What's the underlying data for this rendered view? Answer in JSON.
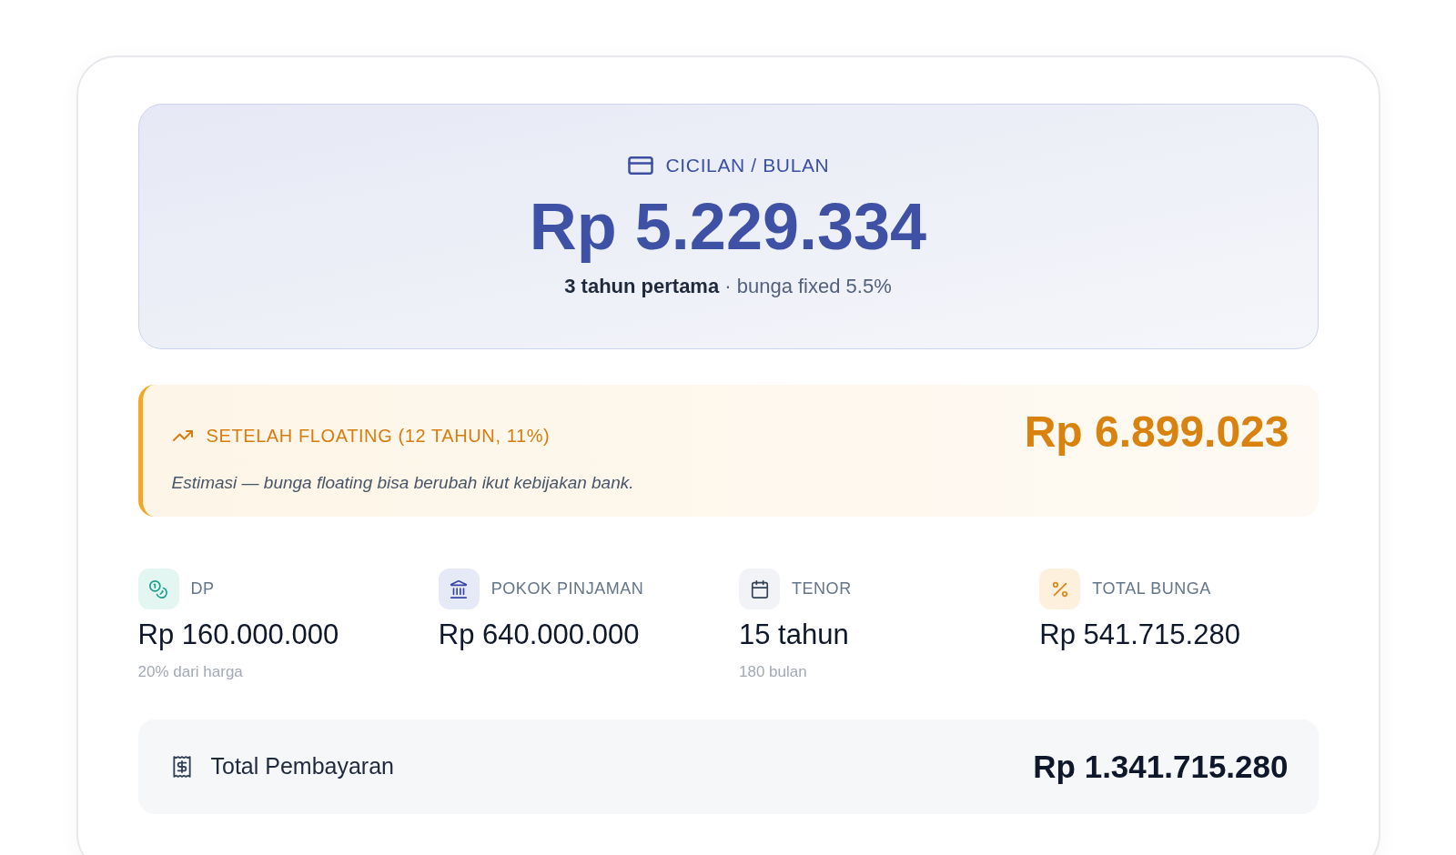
{
  "installment": {
    "label": "CICILAN / BULAN",
    "amount": "Rp 5.229.334",
    "subtitle": "**3 tahun pertama** · bunga fixed 5.5%"
  },
  "floating": {
    "label": "SETELAH FLOATING (12 TAHUN, 11%)",
    "note": "Estimasi — bunga floating bisa berubah ikut kebijakan bank.",
    "amount": "Rp 6.899.023"
  },
  "stats": [
    {
      "label": "DP",
      "value": "Rp 160.000.000",
      "note": "20% dari harga"
    },
    {
      "label": "POKOK PINJAMAN",
      "value": "Rp 640.000.000"
    },
    {
      "label": "TENOR",
      "value": "15 tahun",
      "note": "180 bulan"
    },
    {
      "label": "TOTAL BUNGA",
      "value": "Rp 541.715.280"
    }
  ],
  "total": {
    "label": "Total Pembayaran",
    "amount": "Rp 1.341.715.280"
  }
}
